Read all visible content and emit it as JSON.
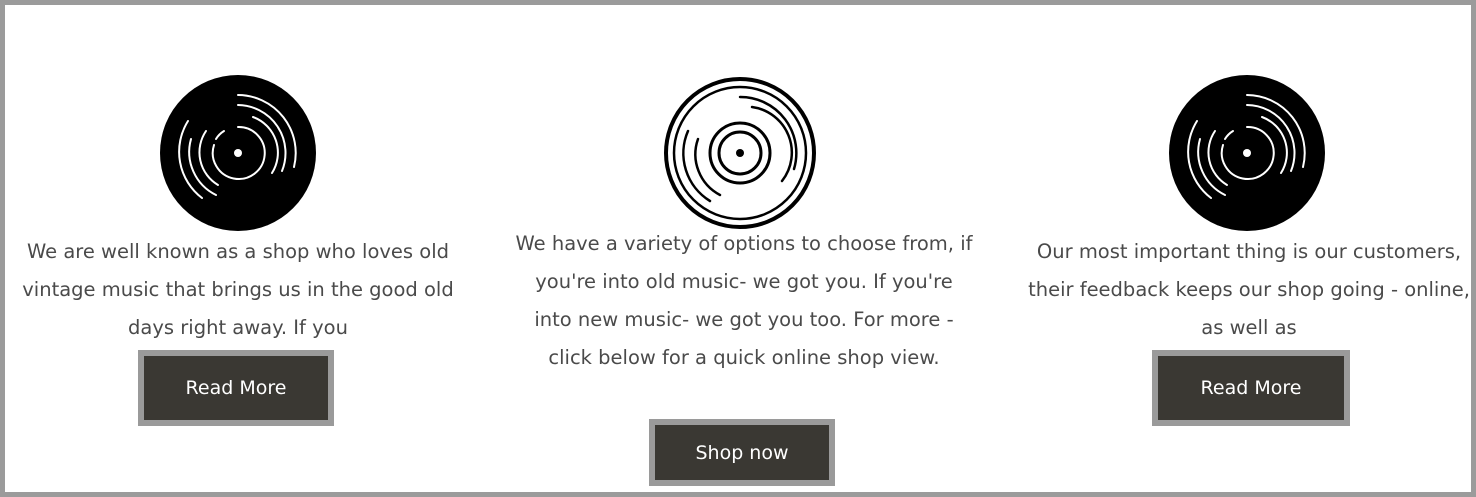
{
  "columns": [
    {
      "icon": "vinyl-record-icon",
      "text": "We are well known as a shop who loves old vintage music that brings us in the good old days right away. If you",
      "button_label": "Read More"
    },
    {
      "icon": "vinyl-record-outline-icon",
      "text": "We have a variety of options to choose from, if you're into old music- we got you. If you're into new music- we got you too. For more - click below for a quick online shop view.",
      "button_label": "Shop now"
    },
    {
      "icon": "vinyl-record-icon",
      "text": "Our most important thing is our customers, their feedback keeps our shop going - online, as well as",
      "button_label": "Read More"
    }
  ],
  "colors": {
    "frame_border": "#9b9b9b",
    "text": "#4a4a4a",
    "button_bg": "#3a3833",
    "button_border": "#9a9a9a",
    "button_text": "#ffffff",
    "icon": "#000000"
  }
}
